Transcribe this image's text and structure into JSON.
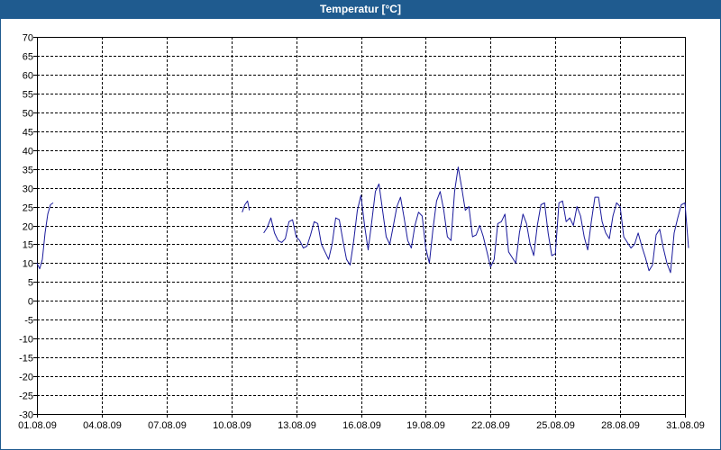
{
  "window": {
    "title": "Temperatur [°C]"
  },
  "chart_data": {
    "type": "line",
    "title": "Temperatur [°C]",
    "xlabel": "",
    "ylabel": "",
    "ylim": [
      -30,
      70
    ],
    "yticks": [
      70,
      65,
      60,
      55,
      50,
      45,
      40,
      35,
      30,
      25,
      20,
      15,
      10,
      5,
      0,
      -5,
      -10,
      -15,
      -20,
      -25,
      -30
    ],
    "xlim": [
      "01.08.09",
      "31.08.09"
    ],
    "xticks": [
      "01.08.09",
      "04.08.09",
      "07.08.09",
      "10.08.09",
      "13.08.09",
      "16.08.09",
      "19.08.09",
      "22.08.09",
      "25.08.09",
      "28.08.09",
      "31.08.09"
    ],
    "grid": true,
    "line_color": "#1a1a9c",
    "series": [
      {
        "segments": [
          {
            "x": [
              "01.08.09 00:00",
              "01.08.09 03:00",
              "01.08.09 06:00",
              "01.08.09 09:00",
              "01.08.09 12:00",
              "01.08.09 15:00",
              "01.08.09 18:00"
            ],
            "y": [
              10,
              8.5,
              11,
              18,
              23,
              25.5,
              26
            ]
          },
          {
            "x": [
              "10.08.09 12:00",
              "10.08.09 15:00",
              "10.08.09 18:00",
              "10.08.09 20:00"
            ],
            "y": [
              23.5,
              25.5,
              26.5,
              24
            ]
          },
          {
            "x": [
              "11.08.09 12:00",
              "11.08.09 16:00",
              "11.08.09 20:00",
              "12.08.09 00:00",
              "12.08.09 04:00",
              "12.08.09 08:00",
              "12.08.09 12:00",
              "12.08.09 16:00",
              "12.08.09 20:00",
              "13.08.09 00:00",
              "13.08.09 04:00",
              "13.08.09 08:00",
              "13.08.09 12:00",
              "13.08.09 16:00",
              "13.08.09 20:00",
              "14.08.09 00:00",
              "14.08.09 04:00",
              "14.08.09 08:00",
              "14.08.09 12:00",
              "14.08.09 16:00",
              "14.08.09 20:00",
              "15.08.09 00:00",
              "15.08.09 04:00",
              "15.08.09 08:00",
              "15.08.09 12:00",
              "15.08.09 16:00",
              "15.08.09 20:00",
              "16.08.09 00:00",
              "16.08.09 04:00",
              "16.08.09 08:00",
              "16.08.09 12:00",
              "16.08.09 16:00",
              "16.08.09 20:00",
              "17.08.09 00:00",
              "17.08.09 04:00",
              "17.08.09 08:00",
              "17.08.09 12:00",
              "17.08.09 16:00",
              "17.08.09 20:00",
              "18.08.09 00:00",
              "18.08.09 04:00",
              "18.08.09 08:00",
              "18.08.09 12:00",
              "18.08.09 16:00",
              "18.08.09 20:00",
              "19.08.09 00:00",
              "19.08.09 04:00",
              "19.08.09 08:00",
              "19.08.09 12:00",
              "19.08.09 16:00",
              "19.08.09 20:00",
              "20.08.09 00:00",
              "20.08.09 04:00",
              "20.08.09 08:00",
              "20.08.09 12:00",
              "20.08.09 16:00",
              "20.08.09 20:00",
              "21.08.09 00:00",
              "21.08.09 04:00",
              "21.08.09 08:00",
              "21.08.09 12:00",
              "21.08.09 16:00",
              "21.08.09 20:00",
              "22.08.09 00:00",
              "22.08.09 04:00",
              "22.08.09 08:00",
              "22.08.09 12:00",
              "22.08.09 16:00",
              "22.08.09 20:00",
              "23.08.09 00:00",
              "23.08.09 04:00",
              "23.08.09 08:00",
              "23.08.09 12:00",
              "23.08.09 16:00",
              "23.08.09 20:00",
              "24.08.09 00:00",
              "24.08.09 04:00",
              "24.08.09 08:00",
              "24.08.09 12:00",
              "24.08.09 16:00",
              "24.08.09 20:00",
              "25.08.09 00:00",
              "25.08.09 04:00",
              "25.08.09 08:00",
              "25.08.09 12:00",
              "25.08.09 16:00",
              "25.08.09 20:00",
              "26.08.09 00:00",
              "26.08.09 04:00",
              "26.08.09 08:00",
              "26.08.09 12:00",
              "26.08.09 16:00",
              "26.08.09 20:00",
              "27.08.09 00:00",
              "27.08.09 04:00",
              "27.08.09 08:00",
              "27.08.09 12:00",
              "27.08.09 16:00",
              "27.08.09 20:00",
              "28.08.09 00:00",
              "28.08.09 04:00",
              "28.08.09 08:00",
              "28.08.09 12:00",
              "28.08.09 16:00",
              "28.08.09 20:00",
              "29.08.09 00:00",
              "29.08.09 04:00",
              "29.08.09 08:00",
              "29.08.09 12:00",
              "29.08.09 16:00",
              "29.08.09 20:00",
              "30.08.09 00:00",
              "30.08.09 04:00",
              "30.08.09 08:00",
              "30.08.09 12:00",
              "30.08.09 16:00",
              "30.08.09 20:00",
              "31.08.09 00:00",
              "31.08.09 04:00",
              "31.08.09 08:00",
              "31.08.09 12:00",
              "31.08.09 16:00",
              "31.08.09 20:00"
            ],
            "y": [
              18,
              19.5,
              22,
              18,
              16,
              15.5,
              16.5,
              21,
              21.5,
              17,
              16,
              14,
              14.5,
              17.5,
              21,
              20.5,
              15,
              13,
              11,
              15,
              22,
              21.5,
              16,
              11,
              9.5,
              16,
              24,
              28,
              20,
              13.5,
              21,
              29,
              31,
              24,
              17,
              15,
              20,
              25,
              27.5,
              22,
              16,
              14,
              20,
              23.5,
              22.5,
              14,
              10,
              19,
              26.5,
              29,
              24,
              17,
              16,
              29,
              35.5,
              30,
              24,
              25,
              17,
              17.5,
              20,
              17,
              13,
              9,
              11,
              20.5,
              21,
              23,
              13,
              11.5,
              10,
              18,
              23,
              20.5,
              15,
              12,
              20,
              25.5,
              26,
              18,
              12,
              12.5,
              26,
              26.5,
              21,
              22,
              20,
              25,
              22.5,
              17,
              13.5,
              21,
              27.5,
              27.5,
              21,
              18,
              16.5,
              22.5,
              26,
              25,
              17,
              15.5,
              14,
              15,
              18,
              14.5,
              11.5,
              8,
              9.5,
              17.5,
              19,
              14,
              10,
              7.5,
              18,
              22,
              25.5,
              26,
              14
            ]
          }
        ]
      }
    ]
  }
}
